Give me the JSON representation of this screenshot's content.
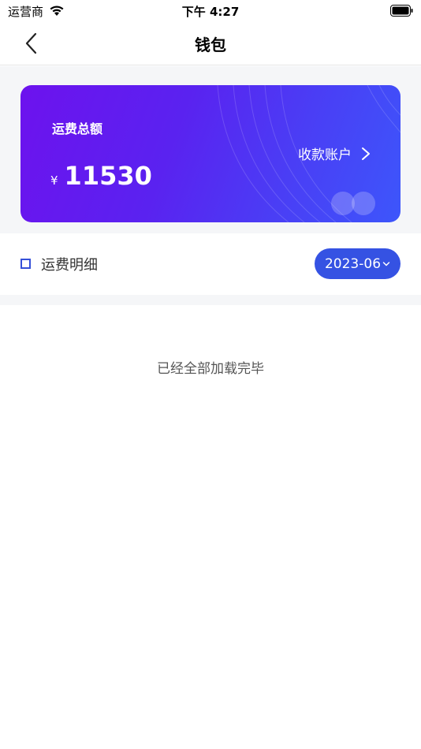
{
  "status_bar": {
    "carrier": "运营商",
    "time": "下午 4:27"
  },
  "nav": {
    "title": "钱包",
    "back_icon": "chevron-left-icon"
  },
  "card": {
    "label": "运费总额",
    "currency": "¥",
    "amount": "11530",
    "account_link": "收款账户",
    "gradient_start": "#6d12ee",
    "gradient_end": "#3d56fb"
  },
  "detail": {
    "label": "运费明细",
    "month": "2023-06",
    "accent": "#3552e3"
  },
  "list": {
    "end_text": "已经全部加载完毕"
  }
}
